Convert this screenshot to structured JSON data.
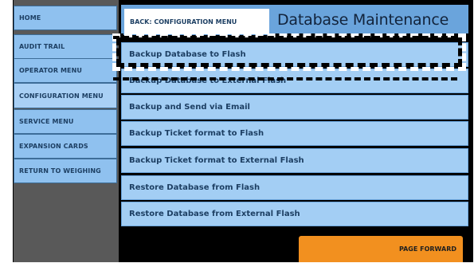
{
  "sidebar": {
    "items": [
      {
        "label": "HOME"
      },
      {
        "label": "AUDIT TRAIL"
      },
      {
        "label": "OPERATOR MENU"
      },
      {
        "label": "CONFIGURATION MENU"
      },
      {
        "label": "SERVICE MENU"
      },
      {
        "label": "EXPANSION CARDS"
      },
      {
        "label": "RETURN TO WEIGHING"
      }
    ]
  },
  "header": {
    "back_label": "BACK: CONFIGURATION MENU",
    "title": "Database Maintenance"
  },
  "menu": {
    "items": [
      {
        "label": "Backup Database to Flash"
      },
      {
        "label": "Backup Database to External Flash"
      },
      {
        "label": "Backup and Send via Email"
      },
      {
        "label": "Backup Ticket format to Flash"
      },
      {
        "label": "Backup Ticket format to External Flash"
      },
      {
        "label": "Restore Database from Flash"
      },
      {
        "label": "Restore Database from External Flash"
      }
    ]
  },
  "footer": {
    "page_forward_label": "PAGE FORWARD"
  },
  "colors": {
    "button_blue": "#8fc1ef",
    "row_blue": "#a3cef4",
    "title_blue": "#6aa4dc",
    "accent_orange": "#f2901f",
    "panel_gray": "#595959"
  }
}
